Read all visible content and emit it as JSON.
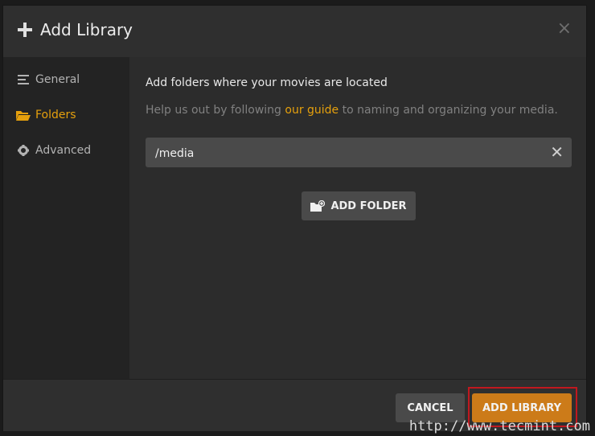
{
  "dialog": {
    "title": "Add Library",
    "close_label": "×"
  },
  "sidebar": {
    "items": [
      {
        "label": "General",
        "icon": "list-icon"
      },
      {
        "label": "Folders",
        "icon": "folder-open-icon",
        "active": true
      },
      {
        "label": "Advanced",
        "icon": "gear-icon"
      }
    ]
  },
  "main": {
    "heading": "Add folders where your movies are located",
    "help_prefix": "Help us out by following ",
    "help_link": "our guide",
    "help_suffix": " to naming and organizing your media.",
    "folder_value": "/media",
    "clear_label": "✕",
    "add_folder_label": "ADD FOLDER"
  },
  "footer": {
    "cancel_label": "CANCEL",
    "add_library_label": "ADD LIBRARY"
  },
  "watermark": "http://www.tecmint.com",
  "colors": {
    "accent": "#e5a00d",
    "primary_button": "#cc7b19",
    "highlight_border": "#c0181f"
  }
}
